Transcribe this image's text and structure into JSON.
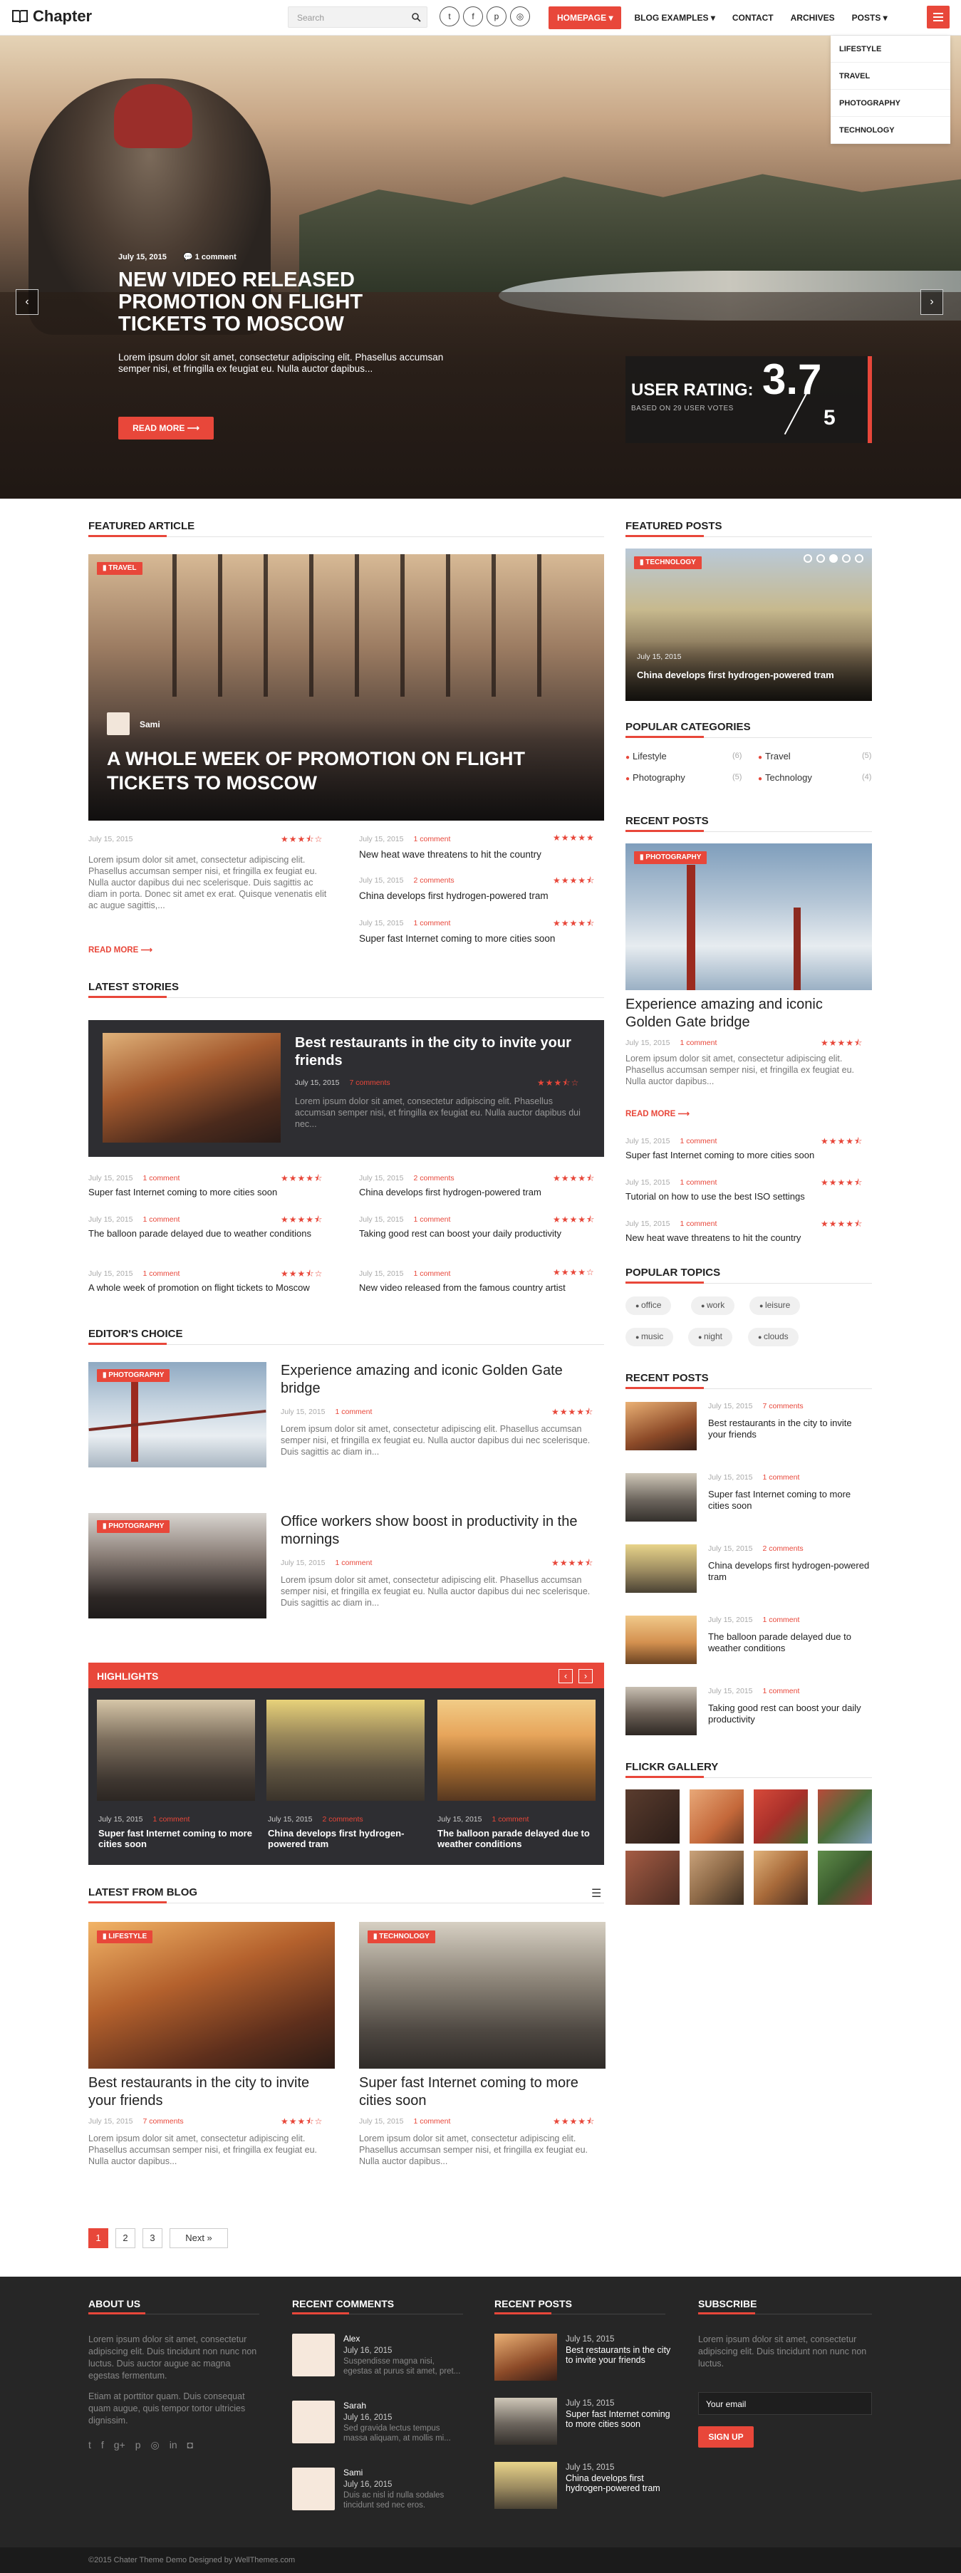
{
  "header": {
    "logo": "Chapter",
    "search_placeholder": "Search",
    "social": [
      "twitter-icon",
      "facebook-icon",
      "pinterest-icon",
      "instagram-icon"
    ],
    "nav": {
      "homepage": "HOMEPAGE",
      "blog_examples": "BLOG EXAMPLES",
      "contact": "CONTACT",
      "archives": "ARCHIVES",
      "posts": "POSTS"
    },
    "dropdown": [
      "LIFESTYLE",
      "TRAVEL",
      "PHOTOGRAPHY",
      "TECHNOLOGY"
    ]
  },
  "hero": {
    "date": "July 15, 2015",
    "comments": "1 comment",
    "title": "New Video Released Promotion on Flight Tickets to Moscow",
    "excerpt": "Lorem ipsum dolor sit amet, consectetur adipiscing elit. Phasellus accumsan semper nisi, et fringilla ex feugiat eu. Nulla auctor dapibus...",
    "read_more": "READ MORE ⟶",
    "rating_label": "USER RATING:",
    "rating_sub": "BASED ON 29 USER VOTES",
    "rating_value": "3.7",
    "rating_max": "5"
  },
  "featured": {
    "section": "FEATURED ARTICLE",
    "tag": "TRAVEL",
    "author": "Sami",
    "title": "A WHOLE WEEK OF PROMOTION ON FLIGHT TICKETS TO MOSCOW",
    "date": "July 15, 2015",
    "rating": 3.5,
    "excerpt": "Lorem ipsum dolor sit amet, consectetur adipiscing elit. Phasellus accumsan semper nisi, et fringilla ex feugiat eu. Nulla auctor dapibus dui nec scelerisque. Duis sagittis ac diam in porta. Donec sit amet ex erat. Quisque venenatis elit ac augue sagittis,...",
    "read_more": "READ MORE ⟶",
    "side": [
      {
        "date": "July 15, 2015",
        "comments": "1 comment",
        "title": "New heat wave threatens to hit the country",
        "rating": 5
      },
      {
        "date": "July 15, 2015",
        "comments": "2 comments",
        "title": "China develops first hydrogen-powered tram",
        "rating": 4.5
      },
      {
        "date": "July 15, 2015",
        "comments": "1 comment",
        "title": "Super fast Internet coming to more cities soon",
        "rating": 4.5
      }
    ]
  },
  "latest": {
    "section": "LATEST STORIES",
    "main": {
      "title": "Best restaurants in the city to invite your friends",
      "date": "July 15, 2015",
      "comments": "7 comments",
      "rating": 3.5,
      "excerpt": "Lorem ipsum dolor sit amet, consectetur adipiscing elit. Phasellus accumsan semper nisi, et fringilla ex feugiat eu. Nulla auctor dapibus dui nec..."
    },
    "items": [
      {
        "date": "July 15, 2015",
        "comments": "1 comment",
        "title": "Super fast Internet coming to more cities soon",
        "rating": 4.5
      },
      {
        "date": "July 15, 2015",
        "comments": "2 comments",
        "title": "China develops first hydrogen-powered tram",
        "rating": 4.5
      },
      {
        "date": "July 15, 2015",
        "comments": "1 comment",
        "title": "The balloon parade delayed due to weather conditions",
        "rating": 4.5
      },
      {
        "date": "July 15, 2015",
        "comments": "1 comment",
        "title": "Taking good rest can boost your daily productivity",
        "rating": 4.5
      },
      {
        "date": "July 15, 2015",
        "comments": "1 comment",
        "title": "A whole week of promotion on flight tickets to Moscow",
        "rating": 3.5
      },
      {
        "date": "July 15, 2015",
        "comments": "1 comment",
        "title": "New video released from the famous country artist",
        "rating": 4
      }
    ]
  },
  "editors": {
    "section": "EDITOR'S CHOICE",
    "items": [
      {
        "tag": "PHOTOGRAPHY",
        "title": "Experience amazing and iconic Golden Gate bridge",
        "date": "July 15, 2015",
        "comments": "1 comment",
        "rating": 4.5,
        "excerpt": "Lorem ipsum dolor sit amet, consectetur adipiscing elit. Phasellus accumsan semper nisi, et fringilla ex feugiat eu. Nulla auctor dapibus dui nec scelerisque. Duis sagittis ac diam in..."
      },
      {
        "tag": "PHOTOGRAPHY",
        "title": "Office workers show boost in productivity in the mornings",
        "date": "July 15, 2015",
        "comments": "1 comment",
        "rating": 4.5,
        "excerpt": "Lorem ipsum dolor sit amet, consectetur adipiscing elit. Phasellus accumsan semper nisi, et fringilla ex feugiat eu. Nulla auctor dapibus dui nec scelerisque. Duis sagittis ac diam in..."
      }
    ]
  },
  "highlights": {
    "section": "HIGHLIGHTS",
    "items": [
      {
        "date": "July 15, 2015",
        "comments": "1 comment",
        "title": "Super fast Internet coming to more cities soon"
      },
      {
        "date": "July 15, 2015",
        "comments": "2 comments",
        "title": "China develops first hydrogen-powered tram"
      },
      {
        "date": "July 15, 2015",
        "comments": "1 comment",
        "title": "The balloon parade delayed due to weather conditions"
      }
    ]
  },
  "blog": {
    "section": "LATEST FROM BLOG",
    "items": [
      {
        "tag": "LIFESTYLE",
        "title": "Best restaurants in the city to invite your friends",
        "date": "July 15, 2015",
        "comments": "7 comments",
        "rating": 3.5,
        "excerpt": "Lorem ipsum dolor sit amet, consectetur adipiscing elit. Phasellus accumsan semper nisi, et fringilla ex feugiat eu. Nulla auctor dapibus..."
      },
      {
        "tag": "TECHNOLOGY",
        "title": "Super fast Internet coming to more cities soon",
        "date": "July 15, 2015",
        "comments": "1 comment",
        "rating": 4.5,
        "excerpt": "Lorem ipsum dolor sit amet, consectetur adipiscing elit. Phasellus accumsan semper nisi, et fringilla ex feugiat eu. Nulla auctor dapibus..."
      }
    ]
  },
  "pagination": {
    "pages": [
      "1",
      "2",
      "3"
    ],
    "next": "Next »"
  },
  "sidebar": {
    "featured_posts": {
      "title": "FEATURED POSTS",
      "tag": "TECHNOLOGY",
      "date": "July 15, 2015",
      "post": "China develops first hydrogen-powered tram"
    },
    "categories": {
      "title": "POPULAR CATEGORIES",
      "items": [
        {
          "name": "Lifestyle",
          "count": "(6)"
        },
        {
          "name": "Travel",
          "count": "(5)"
        },
        {
          "name": "Photography",
          "count": "(5)"
        },
        {
          "name": "Technology",
          "count": "(4)"
        }
      ]
    },
    "recent": {
      "title": "RECENT POSTS",
      "tag": "PHOTOGRAPHY",
      "main_title": "Experience amazing and iconic Golden Gate bridge",
      "main_date": "July 15, 2015",
      "main_comments": "1 comment",
      "main_rating": 4.5,
      "main_excerpt": "Lorem ipsum dolor sit amet, consectetur adipiscing elit. Phasellus accumsan semper nisi, et fringilla ex feugiat eu. Nulla auctor dapibus...",
      "read_more": "READ MORE ⟶",
      "items": [
        {
          "date": "July 15, 2015",
          "comments": "1 comment",
          "title": "Super fast Internet coming to more cities soon",
          "rating": 4.5
        },
        {
          "date": "July 15, 2015",
          "comments": "1 comment",
          "title": "Tutorial on how to use the best ISO settings",
          "rating": 4.5
        },
        {
          "date": "July 15, 2015",
          "comments": "1 comment",
          "title": "New heat wave threatens to hit the country",
          "rating": 4.5
        }
      ]
    },
    "topics": {
      "title": "POPULAR TOPICS",
      "items": [
        "office",
        "work",
        "leisure",
        "music",
        "night",
        "clouds"
      ]
    },
    "recent2": {
      "title": "RECENT POSTS",
      "items": [
        {
          "date": "July 15, 2015",
          "comments": "7 comments",
          "title": "Best restaurants in the city to invite your friends"
        },
        {
          "date": "July 15, 2015",
          "comments": "1 comment",
          "title": "Super fast Internet coming to more cities soon"
        },
        {
          "date": "July 15, 2015",
          "comments": "2 comments",
          "title": "China develops first hydrogen-powered tram"
        },
        {
          "date": "July 15, 2015",
          "comments": "1 comment",
          "title": "The balloon parade delayed due to weather conditions"
        },
        {
          "date": "July 15, 2015",
          "comments": "1 comment",
          "title": "Taking good rest can boost your daily productivity"
        }
      ]
    },
    "flickr": {
      "title": "FLICKR GALLERY"
    }
  },
  "footer": {
    "about": {
      "title": "ABOUT US",
      "p1": "Lorem ipsum dolor sit amet, consectetur adipiscing elit. Duis tincidunt non nunc non luctus. Duis auctor augue ac magna egestas fermentum.",
      "p2": "Etiam at porttitor quam. Duis consequat quam augue, quis tempor tortor ultricies dignissim."
    },
    "comments": {
      "title": "RECENT COMMENTS",
      "items": [
        {
          "name": "Alex",
          "date": "July 16, 2015",
          "text": "Suspendisse magna nisi, egestas at purus sit amet, pret..."
        },
        {
          "name": "Sarah",
          "date": "July 16, 2015",
          "text": "Sed gravida lectus tempus massa aliquam, at mollis mi..."
        },
        {
          "name": "Sami",
          "date": "July 16, 2015",
          "text": "Duis ac nisl id nulla sodales tincidunt sed nec eros."
        }
      ]
    },
    "posts": {
      "title": "RECENT POSTS",
      "items": [
        {
          "date": "July 15, 2015",
          "title": "Best restaurants in the city to invite your friends"
        },
        {
          "date": "July 15, 2015",
          "title": "Super fast Internet coming to more cities soon"
        },
        {
          "date": "July 15, 2015",
          "title": "China develops first hydrogen-powered tram"
        }
      ]
    },
    "subscribe": {
      "title": "SUBSCRIBE",
      "text": "Lorem ipsum dolor sit amet, consectetur adipiscing elit. Duis tincidunt non nunc non luctus.",
      "placeholder": "Your email",
      "button": "SIGN UP"
    },
    "copyright": "©2015 Chater Theme Demo Designed by WellThemes.com"
  },
  "colors": {
    "accent": "#e8473a",
    "footer_bg": "#262626",
    "dark_card": "#2e2e32"
  }
}
